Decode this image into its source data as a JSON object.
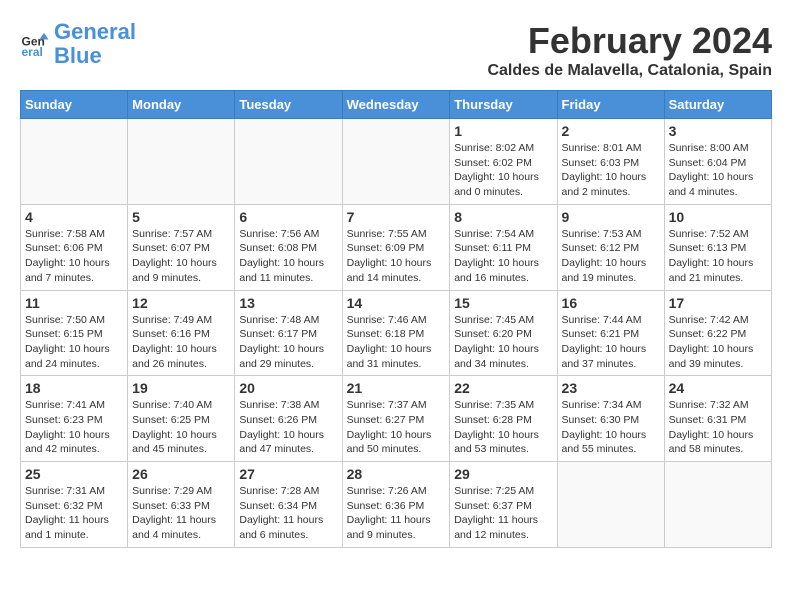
{
  "header": {
    "logo_line1": "General",
    "logo_line2": "Blue",
    "month_year": "February 2024",
    "location": "Caldes de Malavella, Catalonia, Spain"
  },
  "weekdays": [
    "Sunday",
    "Monday",
    "Tuesday",
    "Wednesday",
    "Thursday",
    "Friday",
    "Saturday"
  ],
  "weeks": [
    [
      {
        "day": "",
        "info": ""
      },
      {
        "day": "",
        "info": ""
      },
      {
        "day": "",
        "info": ""
      },
      {
        "day": "",
        "info": ""
      },
      {
        "day": "1",
        "info": "Sunrise: 8:02 AM\nSunset: 6:02 PM\nDaylight: 10 hours\nand 0 minutes."
      },
      {
        "day": "2",
        "info": "Sunrise: 8:01 AM\nSunset: 6:03 PM\nDaylight: 10 hours\nand 2 minutes."
      },
      {
        "day": "3",
        "info": "Sunrise: 8:00 AM\nSunset: 6:04 PM\nDaylight: 10 hours\nand 4 minutes."
      }
    ],
    [
      {
        "day": "4",
        "info": "Sunrise: 7:58 AM\nSunset: 6:06 PM\nDaylight: 10 hours\nand 7 minutes."
      },
      {
        "day": "5",
        "info": "Sunrise: 7:57 AM\nSunset: 6:07 PM\nDaylight: 10 hours\nand 9 minutes."
      },
      {
        "day": "6",
        "info": "Sunrise: 7:56 AM\nSunset: 6:08 PM\nDaylight: 10 hours\nand 11 minutes."
      },
      {
        "day": "7",
        "info": "Sunrise: 7:55 AM\nSunset: 6:09 PM\nDaylight: 10 hours\nand 14 minutes."
      },
      {
        "day": "8",
        "info": "Sunrise: 7:54 AM\nSunset: 6:11 PM\nDaylight: 10 hours\nand 16 minutes."
      },
      {
        "day": "9",
        "info": "Sunrise: 7:53 AM\nSunset: 6:12 PM\nDaylight: 10 hours\nand 19 minutes."
      },
      {
        "day": "10",
        "info": "Sunrise: 7:52 AM\nSunset: 6:13 PM\nDaylight: 10 hours\nand 21 minutes."
      }
    ],
    [
      {
        "day": "11",
        "info": "Sunrise: 7:50 AM\nSunset: 6:15 PM\nDaylight: 10 hours\nand 24 minutes."
      },
      {
        "day": "12",
        "info": "Sunrise: 7:49 AM\nSunset: 6:16 PM\nDaylight: 10 hours\nand 26 minutes."
      },
      {
        "day": "13",
        "info": "Sunrise: 7:48 AM\nSunset: 6:17 PM\nDaylight: 10 hours\nand 29 minutes."
      },
      {
        "day": "14",
        "info": "Sunrise: 7:46 AM\nSunset: 6:18 PM\nDaylight: 10 hours\nand 31 minutes."
      },
      {
        "day": "15",
        "info": "Sunrise: 7:45 AM\nSunset: 6:20 PM\nDaylight: 10 hours\nand 34 minutes."
      },
      {
        "day": "16",
        "info": "Sunrise: 7:44 AM\nSunset: 6:21 PM\nDaylight: 10 hours\nand 37 minutes."
      },
      {
        "day": "17",
        "info": "Sunrise: 7:42 AM\nSunset: 6:22 PM\nDaylight: 10 hours\nand 39 minutes."
      }
    ],
    [
      {
        "day": "18",
        "info": "Sunrise: 7:41 AM\nSunset: 6:23 PM\nDaylight: 10 hours\nand 42 minutes."
      },
      {
        "day": "19",
        "info": "Sunrise: 7:40 AM\nSunset: 6:25 PM\nDaylight: 10 hours\nand 45 minutes."
      },
      {
        "day": "20",
        "info": "Sunrise: 7:38 AM\nSunset: 6:26 PM\nDaylight: 10 hours\nand 47 minutes."
      },
      {
        "day": "21",
        "info": "Sunrise: 7:37 AM\nSunset: 6:27 PM\nDaylight: 10 hours\nand 50 minutes."
      },
      {
        "day": "22",
        "info": "Sunrise: 7:35 AM\nSunset: 6:28 PM\nDaylight: 10 hours\nand 53 minutes."
      },
      {
        "day": "23",
        "info": "Sunrise: 7:34 AM\nSunset: 6:30 PM\nDaylight: 10 hours\nand 55 minutes."
      },
      {
        "day": "24",
        "info": "Sunrise: 7:32 AM\nSunset: 6:31 PM\nDaylight: 10 hours\nand 58 minutes."
      }
    ],
    [
      {
        "day": "25",
        "info": "Sunrise: 7:31 AM\nSunset: 6:32 PM\nDaylight: 11 hours\nand 1 minute."
      },
      {
        "day": "26",
        "info": "Sunrise: 7:29 AM\nSunset: 6:33 PM\nDaylight: 11 hours\nand 4 minutes."
      },
      {
        "day": "27",
        "info": "Sunrise: 7:28 AM\nSunset: 6:34 PM\nDaylight: 11 hours\nand 6 minutes."
      },
      {
        "day": "28",
        "info": "Sunrise: 7:26 AM\nSunset: 6:36 PM\nDaylight: 11 hours\nand 9 minutes."
      },
      {
        "day": "29",
        "info": "Sunrise: 7:25 AM\nSunset: 6:37 PM\nDaylight: 11 hours\nand 12 minutes."
      },
      {
        "day": "",
        "info": ""
      },
      {
        "day": "",
        "info": ""
      }
    ]
  ]
}
